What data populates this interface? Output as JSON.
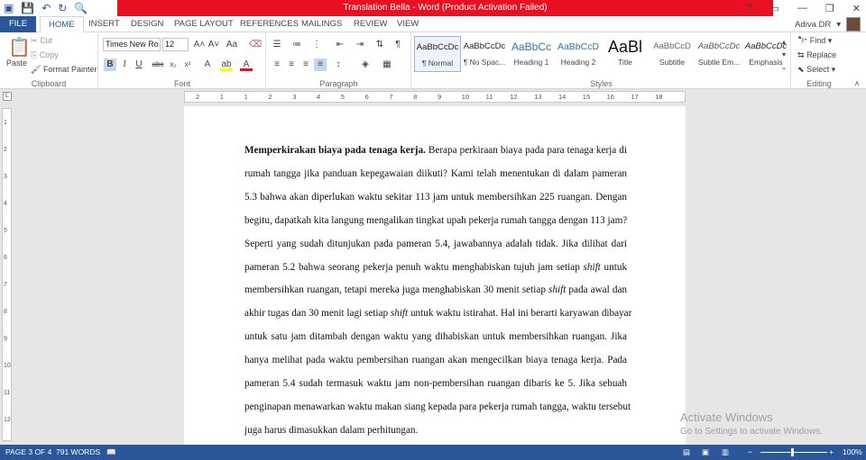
{
  "window": {
    "title": "Translation Bella -  Word (Product Activation Failed)",
    "help": "?",
    "minimize": "—",
    "restore": "❐",
    "close": "✕"
  },
  "user": {
    "name": "Adiva DR"
  },
  "tabs": [
    {
      "label": "FILE"
    },
    {
      "label": "HOME"
    },
    {
      "label": "INSERT"
    },
    {
      "label": "DESIGN"
    },
    {
      "label": "PAGE LAYOUT"
    },
    {
      "label": "REFERENCES"
    },
    {
      "label": "MAILINGS"
    },
    {
      "label": "REVIEW"
    },
    {
      "label": "VIEW"
    }
  ],
  "clipboard": {
    "label": "Clipboard",
    "paste": "Paste",
    "cut": "Cut",
    "copy": "Copy",
    "format_painter": "Format Painter"
  },
  "font": {
    "label": "Font",
    "name": "Times New Ro",
    "size": "12"
  },
  "paragraph": {
    "label": "Paragraph"
  },
  "styles": {
    "label": "Styles",
    "items": [
      {
        "preview": "AaBbCcDc",
        "name": "¶ Normal"
      },
      {
        "preview": "AaBbCcDc",
        "name": "¶ No Spac..."
      },
      {
        "preview": "AaBbCc",
        "name": "Heading 1"
      },
      {
        "preview": "AaBbCcD",
        "name": "Heading 2"
      },
      {
        "preview": "AaBl",
        "name": "Title"
      },
      {
        "preview": "AaBbCcD",
        "name": "Subtitle"
      },
      {
        "preview": "AaBbCcDc",
        "name": "Subtle Em..."
      },
      {
        "preview": "AaBbCcDc",
        "name": "Emphasis"
      }
    ]
  },
  "editing": {
    "label": "Editing",
    "find": "Find",
    "replace": "Replace",
    "select": "Select"
  },
  "ruler": {
    "h_ticks": [
      "2",
      "1",
      "1",
      "2",
      "3",
      "4",
      "5",
      "6",
      "7",
      "8",
      "9",
      "10",
      "11",
      "12",
      "13",
      "14",
      "15",
      "16",
      "17",
      "18"
    ],
    "v_ticks": [
      "1",
      "2",
      "3",
      "4",
      "5",
      "6",
      "7",
      "8",
      "9",
      "10",
      "11",
      "12"
    ]
  },
  "document": {
    "lines": [
      {
        "bold": "Memperkirakan biaya pada tenaga kerja.",
        "text": " Berapa perkiraan biaya pada para tenaga kerja di"
      },
      {
        "text": "rumah tangga jika panduan kepegawaian diikuti? Kami telah menentukan di dalam pameran"
      },
      {
        "text": "5.3 bahwa akan diperlukan waktu sekitar 113 jam untuk membersihkan 225 ruangan. Dengan"
      },
      {
        "text": "begitu, dapatkah kita langung mengalikan tingkat upah pekerja rumah tangga dengan 113 jam?"
      },
      {
        "text": "Seperti yang sudah ditunjukan pada pameran 5.4, jawabannya adalah tidak. Jika dilihat dari"
      },
      {
        "text": "pameran 5.2 bahwa seorang pekerja penuh waktu menghabiskan tujuh jam setiap ",
        "italic": "shift",
        "text2": " untuk"
      },
      {
        "text": "membersihkan ruangan, tetapi mereka juga menghabiskan 30 menit setiap ",
        "italic": "shift",
        "text2": " pada awal dan"
      },
      {
        "text": "akhir tugas dan 30 menit lagi setiap ",
        "italic": "shift",
        "text2": " untuk waktu istirahat. Hal ini berarti karyawan dibayar"
      },
      {
        "text": "untuk satu jam ditambah dengan waktu yang dihabiskan untuk membersihkan ruangan. Jika"
      },
      {
        "text": "hanya melihat pada waktu pembersihan ruangan akan mengecilkan biaya tenaga kerja. Pada"
      },
      {
        "text": "pameran 5.4 sudah termasuk waktu jam non-pembersihan ruangan dibaris ke 5. Jika sebuah"
      },
      {
        "text": "penginapan menawarkan waktu makan siang kepada para pekerja rumah tangga, waktu tersebut"
      },
      {
        "text": "juga harus dimasukkan dalam perhitungan."
      }
    ]
  },
  "activation": {
    "line1": "Activate Windows",
    "line2": "Go to Settings to activate Windows."
  },
  "status": {
    "page": "PAGE 3 OF 4",
    "words": "791 WORDS",
    "zoom": "100%",
    "zoom_level": 1.0
  }
}
